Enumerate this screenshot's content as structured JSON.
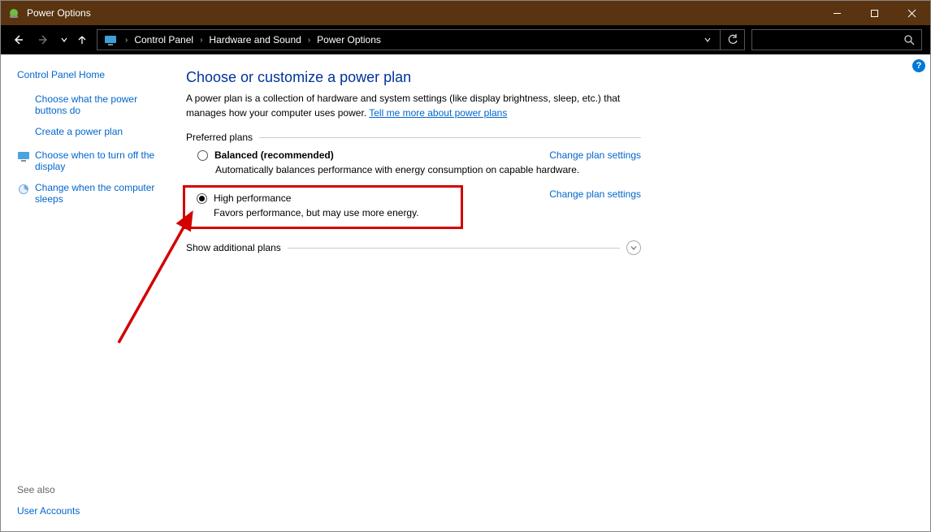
{
  "window": {
    "title": "Power Options"
  },
  "breadcrumb": {
    "items": [
      "Control Panel",
      "Hardware and Sound",
      "Power Options"
    ]
  },
  "sidebar": {
    "home": "Control Panel Home",
    "links": [
      {
        "label": "Choose what the power buttons do"
      },
      {
        "label": "Create a power plan"
      },
      {
        "label": "Choose when to turn off the display"
      },
      {
        "label": "Change when the computer sleeps"
      }
    ],
    "see_also_label": "See also",
    "see_also_links": [
      "User Accounts"
    ]
  },
  "main": {
    "title": "Choose or customize a power plan",
    "description": "A power plan is a collection of hardware and system settings (like display brightness, sleep, etc.) that manages how your computer uses power. ",
    "more_link": "Tell me more about power plans",
    "preferred_label": "Preferred plans",
    "change_settings_label": "Change plan settings",
    "plans": [
      {
        "name": "Balanced (recommended)",
        "desc": "Automatically balances performance with energy consumption on capable hardware.",
        "selected": false
      },
      {
        "name": "High performance",
        "desc": "Favors performance, but may use more energy.",
        "selected": true
      }
    ],
    "additional_label": "Show additional plans"
  }
}
